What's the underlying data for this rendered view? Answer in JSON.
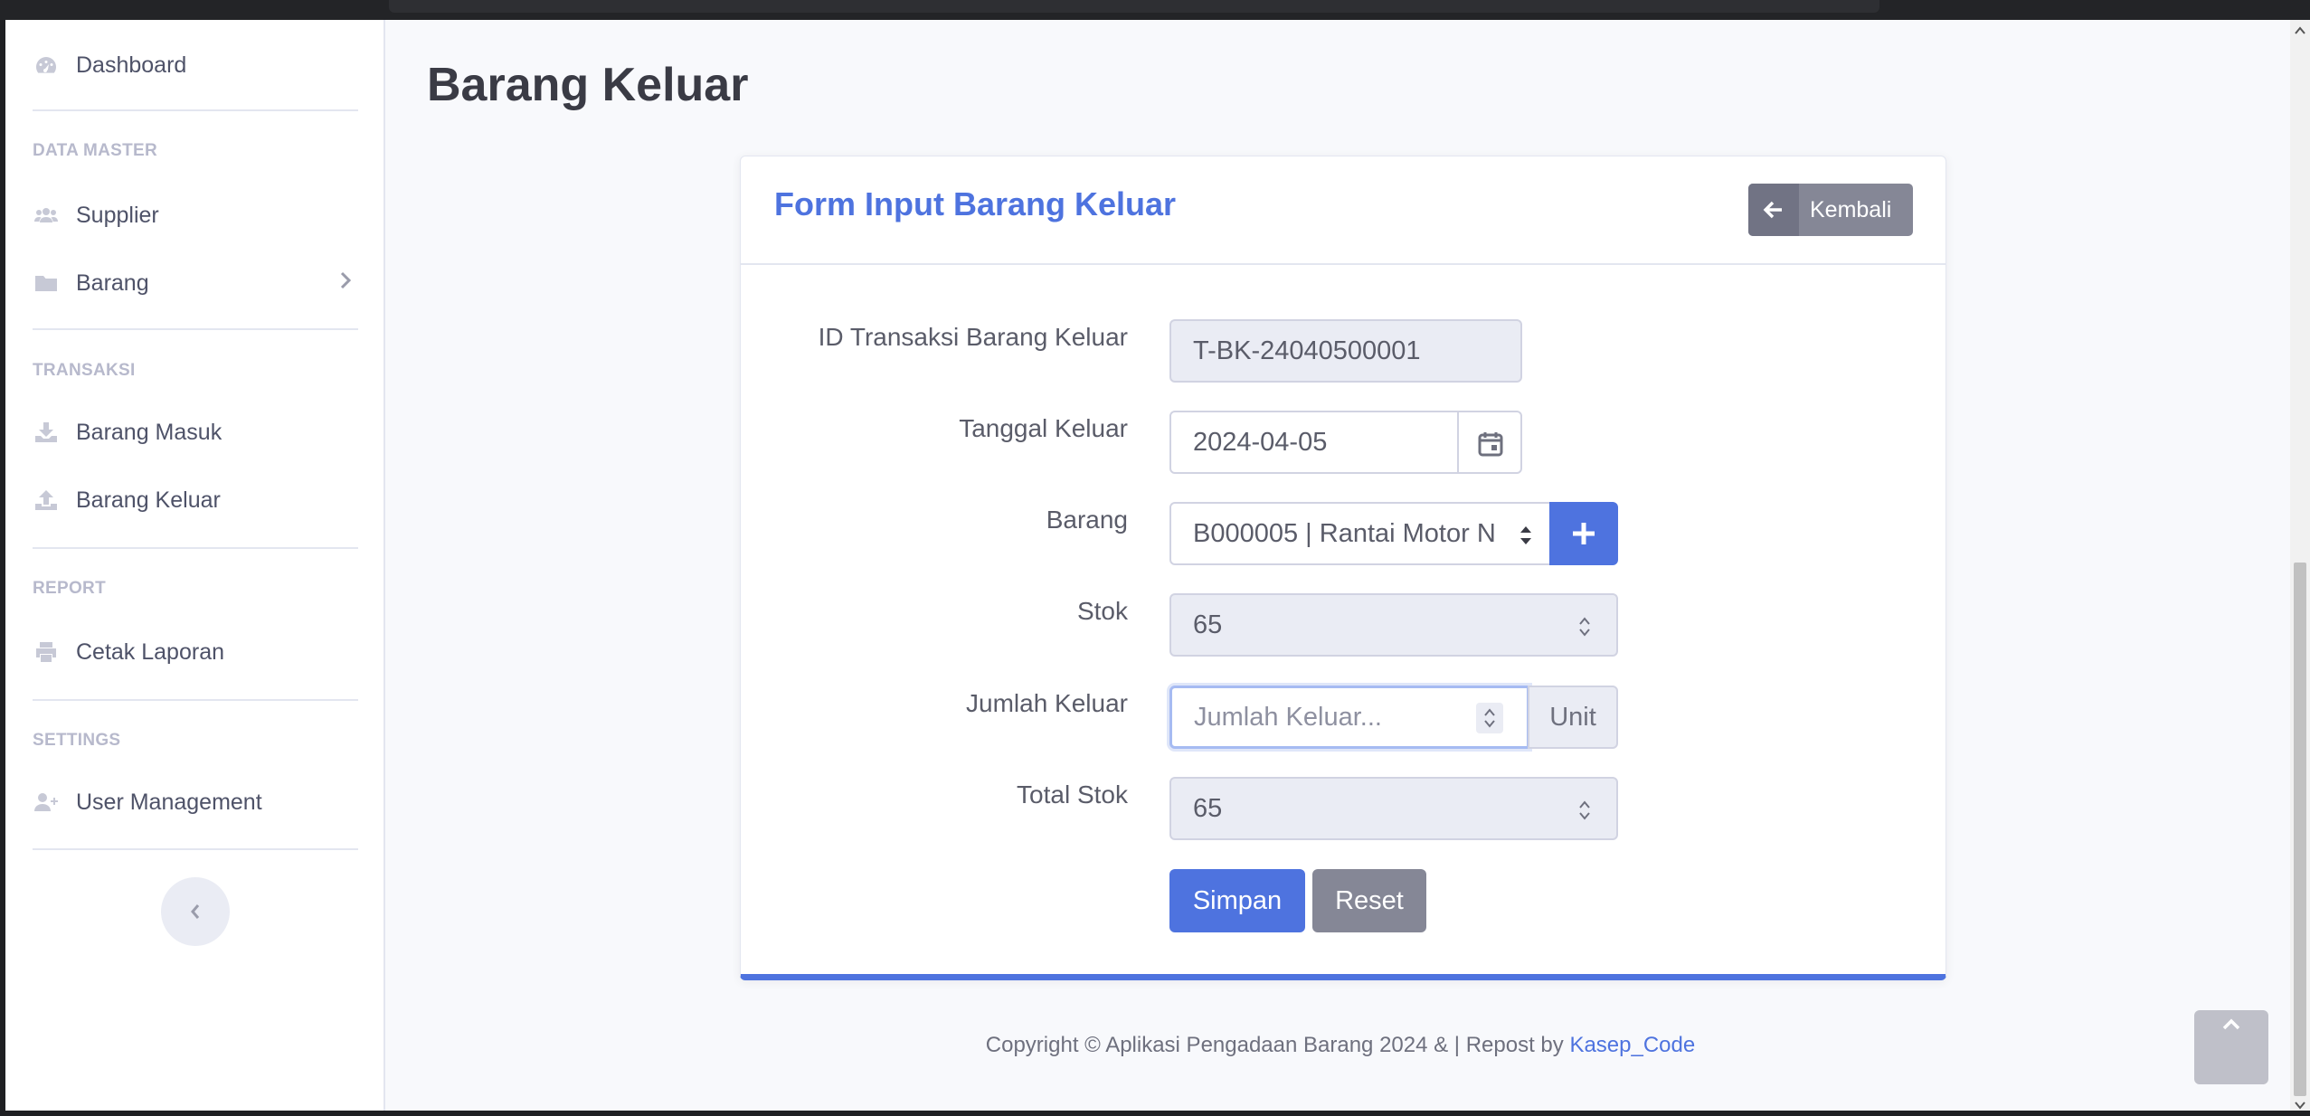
{
  "sidebar": {
    "dashboard": "Dashboard",
    "headings": [
      "DATA MASTER",
      "TRANSAKSI",
      "REPORT",
      "SETTINGS"
    ],
    "supplier": "Supplier",
    "barang": "Barang",
    "barang_masuk": "Barang Masuk",
    "barang_keluar": "Barang Keluar",
    "cetak_laporan": "Cetak Laporan",
    "user_management": "User Management"
  },
  "page": {
    "title": "Barang Keluar"
  },
  "form": {
    "title": "Form Input Barang Keluar",
    "back_label": "Kembali",
    "labels": {
      "id": "ID Transaksi Barang Keluar",
      "tanggal": "Tanggal Keluar",
      "barang": "Barang",
      "stok": "Stok",
      "jumlah": "Jumlah Keluar",
      "total": "Total Stok"
    },
    "values": {
      "id": "T-BK-24040500001",
      "tanggal": "2024-04-05",
      "barang": "B000005 | Rantai Motor N",
      "stok": "65",
      "total": "65"
    },
    "jumlah_placeholder": "Jumlah Keluar...",
    "unit": "Unit",
    "save_label": "Simpan",
    "reset_label": "Reset"
  },
  "footer": {
    "text": "Copyright © Aplikasi Pengadaan Barang 2024 & | Repost by ",
    "link": "Kasep_Code"
  },
  "colors": {
    "primary": "#4e73df",
    "secondary": "#858796",
    "sidebar_text": "#4e5268"
  }
}
